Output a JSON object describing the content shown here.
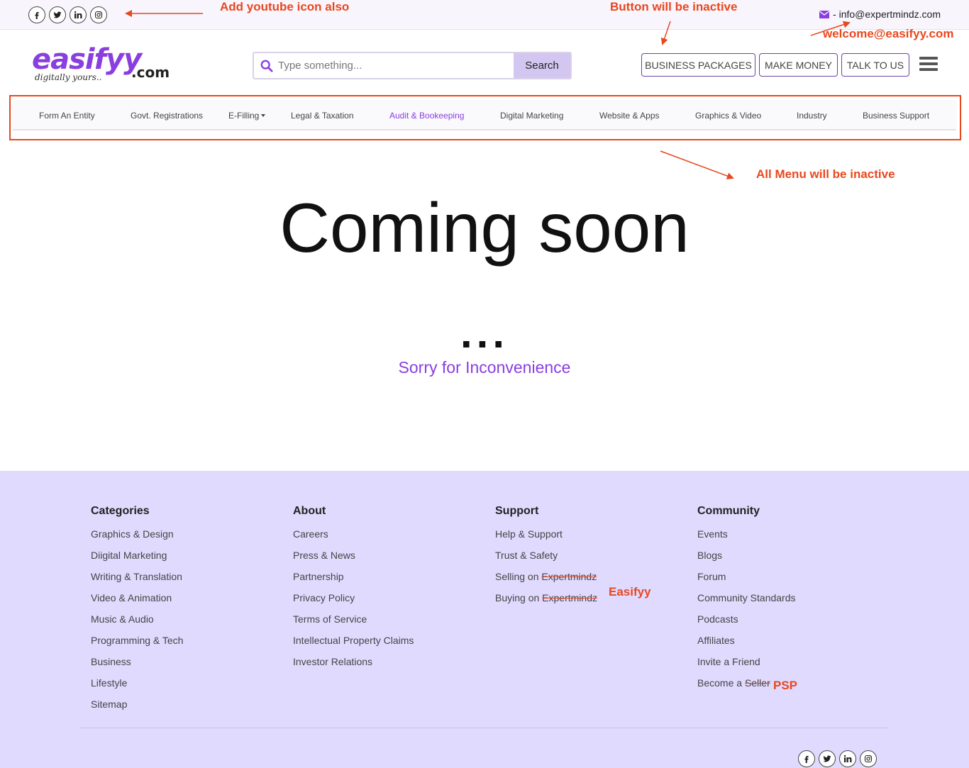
{
  "topbar": {
    "social_icons": [
      "facebook-icon",
      "twitter-icon",
      "linkedin-icon",
      "instagram-icon"
    ],
    "email_icon": "envelope-icon",
    "email_text": "- info@expertmindz.com"
  },
  "header": {
    "logo_text": "easifyy",
    "logo_suffix": ".com",
    "logo_tagline": "digitally yours..",
    "search_placeholder": "Type something...",
    "search_button": "Search",
    "buttons": [
      "BUSINESS PACKAGES",
      "MAKE MONEY",
      "TALK TO US"
    ],
    "menu_icon": "hamburger-icon"
  },
  "nav": {
    "items": [
      "Form An Entity",
      "Govt. Registrations",
      "E-Filling",
      "Legal & Taxation",
      "Audit & Bookeeping",
      "Digital Marketing",
      "Website & Apps",
      "Graphics & Video",
      "Industry",
      "Business Support"
    ],
    "active": "Audit & Bookeeping"
  },
  "main": {
    "title": "Coming soon",
    "dots": "...",
    "subtitle": "Sorry for Inconvenience"
  },
  "footer": {
    "columns": [
      {
        "heading": "Categories",
        "links": [
          "Graphics & Design",
          "Diigital Marketing",
          "Writing & Translation",
          "Video & Animation",
          "Music & Audio",
          "Programming & Tech",
          "Business",
          "Lifestyle",
          "Sitemap"
        ]
      },
      {
        "heading": "About",
        "links": [
          "Careers",
          "Press & News",
          "Partnership",
          "Privacy Policy",
          "Terms of Service",
          "Intellectual Property Claims",
          "Investor Relations"
        ]
      },
      {
        "heading": "Support",
        "links": [
          "Help & Support",
          "Trust & Safety"
        ],
        "selling_prefix": "Selling on ",
        "buying_prefix": "Buying on ",
        "struck_brand": "Expertmindz"
      },
      {
        "heading": "Community",
        "links": [
          "Events",
          "Blogs",
          "Forum",
          "Community Standards",
          "Podcasts",
          "Affiliates",
          "Invite a Friend"
        ],
        "become_prefix": "Become a ",
        "struck_word": "Seller"
      }
    ]
  },
  "annotations": {
    "youtube": "Add youtube icon also",
    "button_inactive": "Button will be inactive",
    "email_replace": "welcome@easifyy.com",
    "menu_inactive": "All Menu will be inactive",
    "easifyy": "Easifyy",
    "psp": "PSP",
    "color": "#e8481e"
  }
}
